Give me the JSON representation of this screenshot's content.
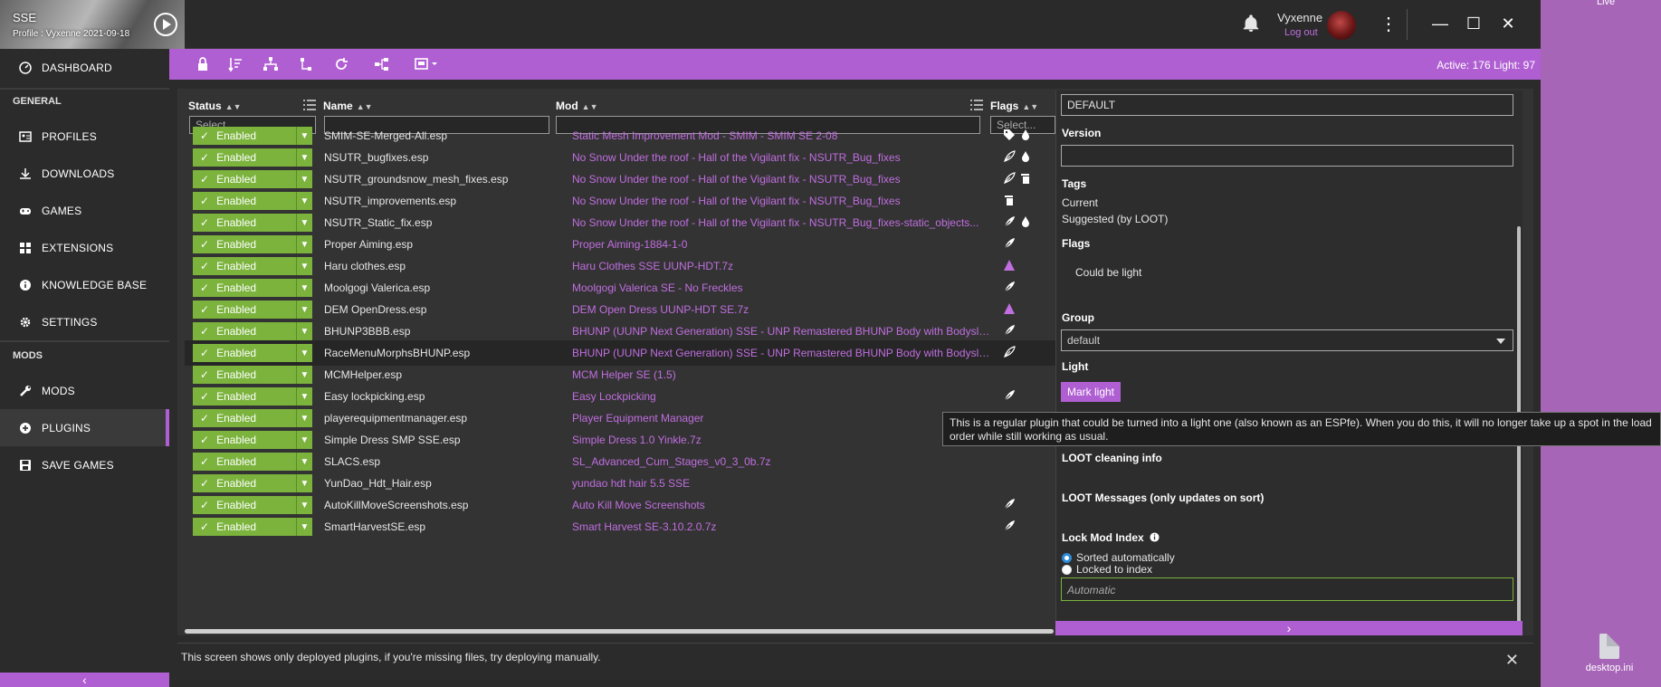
{
  "desktop": {
    "live_label": "Live",
    "file_label": "desktop.ini"
  },
  "titlebar": {
    "game_name": "SSE",
    "profile_text": "Profile : Vyxenne 2021-09-18",
    "username": "Vyxenne",
    "logout_label": "Log out",
    "icons": [
      "bell-icon",
      "kebab-menu-icon",
      "minimize-icon",
      "maximize-icon",
      "close-icon"
    ]
  },
  "sidebar": {
    "dashboard": "DASHBOARD",
    "general_heading": "GENERAL",
    "profiles": "PROFILES",
    "downloads": "DOWNLOADS",
    "games": "GAMES",
    "extensions": "EXTENSIONS",
    "knowledge_base": "KNOWLEDGE BASE",
    "settings": "SETTINGS",
    "mods_heading": "MODS",
    "mods": "MODS",
    "plugins": "PLUGINS",
    "save_games": "SAVE GAMES",
    "collapse_glyph": "‹"
  },
  "toolbar": {
    "active_count": "Active: 176 Light: 97",
    "icons": [
      "lock-icon",
      "sort-icon",
      "network-icon",
      "graph-icon",
      "refresh-icon",
      "groups-icon",
      "screen-dropdown-icon"
    ]
  },
  "table": {
    "col_status": "Status",
    "col_name": "Name",
    "col_mod": "Mod",
    "col_flags": "Flags",
    "filter_placeholder": "Select...",
    "rows": [
      {
        "status": "Enabled",
        "name": "SMIM-SE-Merged-All.esp",
        "mod": "Static Mesh Improvement Mod - SMIM - SMIM SE 2-08",
        "flags": [
          "tag",
          "drop"
        ]
      },
      {
        "status": "Enabled",
        "name": "NSUTR_bugfixes.esp",
        "mod": "No Snow Under the roof - Hall of the Vigilant fix - NSUTR_Bug_fixes",
        "flags": [
          "feather-outline",
          "drop"
        ]
      },
      {
        "status": "Enabled",
        "name": "NSUTR_groundsnow_mesh_fixes.esp",
        "mod": "No Snow Under the roof - Hall of the Vigilant fix - NSUTR_Bug_fixes",
        "flags": [
          "feather-outline",
          "clean"
        ]
      },
      {
        "status": "Enabled",
        "name": "NSUTR_improvements.esp",
        "mod": "No Snow Under the roof - Hall of the Vigilant fix - NSUTR_Bug_fixes",
        "flags": [
          "clean"
        ]
      },
      {
        "status": "Enabled",
        "name": "NSUTR_Static_fix.esp",
        "mod": "No Snow Under the roof - Hall of the Vigilant fix - NSUTR_Bug_fixes-static_objects...",
        "flags": [
          "feather",
          "drop"
        ]
      },
      {
        "status": "Enabled",
        "name": "Proper Aiming.esp",
        "mod": "Proper Aiming-1884-1-0",
        "flags": [
          "feather"
        ]
      },
      {
        "status": "Enabled",
        "name": "Haru clothes.esp",
        "mod": "Haru Clothes SSE UUNP-HDT.7z",
        "flags": [
          "warning"
        ]
      },
      {
        "status": "Enabled",
        "name": "Moolgogi Valerica.esp",
        "mod": "Moolgogi Valerica SE - No Freckles",
        "flags": [
          "feather"
        ]
      },
      {
        "status": "Enabled",
        "name": "DEM OpenDress.esp",
        "mod": "DEM Open Dress UUNP-HDT SE.7z",
        "flags": [
          "warning"
        ]
      },
      {
        "status": "Enabled",
        "name": "BHUNP3BBB.esp",
        "mod": "BHUNP (UUNP Next Generation) SSE - UNP Remastered BHUNP Body with Bodyslide",
        "flags": [
          "feather"
        ]
      },
      {
        "status": "Enabled",
        "name": "RaceMenuMorphsBHUNP.esp",
        "mod": "BHUNP (UUNP Next Generation) SSE - UNP Remastered BHUNP Body with Bodyslide",
        "flags": [
          "feather-outline"
        ]
      },
      {
        "status": "Enabled",
        "name": "MCMHelper.esp",
        "mod": "MCM Helper SE (1.5)",
        "flags": []
      },
      {
        "status": "Enabled",
        "name": "Easy lockpicking.esp",
        "mod": "Easy Lockpicking",
        "flags": [
          "feather"
        ]
      },
      {
        "status": "Enabled",
        "name": "playerequipmentmanager.esp",
        "mod": "Player Equipment Manager",
        "flags": [
          "feather"
        ]
      },
      {
        "status": "Enabled",
        "name": "Simple Dress SMP SSE.esp",
        "mod": "Simple Dress 1.0 Yinkle.7z",
        "flags": []
      },
      {
        "status": "Enabled",
        "name": "SLACS.esp",
        "mod": "SL_Advanced_Cum_Stages_v0_3_0b.7z",
        "flags": []
      },
      {
        "status": "Enabled",
        "name": "YunDao_Hdt_Hair.esp",
        "mod": "yundao hdt hair 5.5 SSE",
        "flags": []
      },
      {
        "status": "Enabled",
        "name": "AutoKillMoveScreenshots.esp",
        "mod": "Auto Kill Move Screenshots",
        "flags": [
          "feather"
        ]
      },
      {
        "status": "Enabled",
        "name": "SmartHarvestSE.esp",
        "mod": "Smart Harvest SE-3.10.2.0.7z",
        "flags": [
          "feather"
        ]
      }
    ]
  },
  "details": {
    "author_value": "DEFAULT",
    "version_label": "Version",
    "version_value": "",
    "tags_label": "Tags",
    "tags_current": "Current",
    "tags_suggested": "Suggested (by LOOT)",
    "flags_label": "Flags",
    "flags_value": "Could be light",
    "group_label": "Group",
    "group_value": "default",
    "light_label": "Light",
    "mark_light_button": "Mark light",
    "loot_cleaning": "LOOT cleaning info",
    "loot_messages": "LOOT Messages (only updates on sort)",
    "lock_index_label": "Lock Mod Index",
    "radio_sorted": "Sorted automatically",
    "radio_locked": "Locked to index",
    "automatic_placeholder": "Automatic",
    "collapse_glyph": "›"
  },
  "tooltip": {
    "text": "This is a regular plugin that could be turned into a light one (also known as an ESPfe). When you do this, it will no longer take up a spot in the load order while still working as usual."
  },
  "footer": {
    "notice": "This screen shows only deployed plugins, if you're missing files, try deploying manually.",
    "close_glyph": "✕"
  },
  "colors": {
    "accent": "#b05fd3",
    "enabled_green": "#7bb33d",
    "mod_link": "#c06ee0",
    "background": "#2b2b2b"
  }
}
